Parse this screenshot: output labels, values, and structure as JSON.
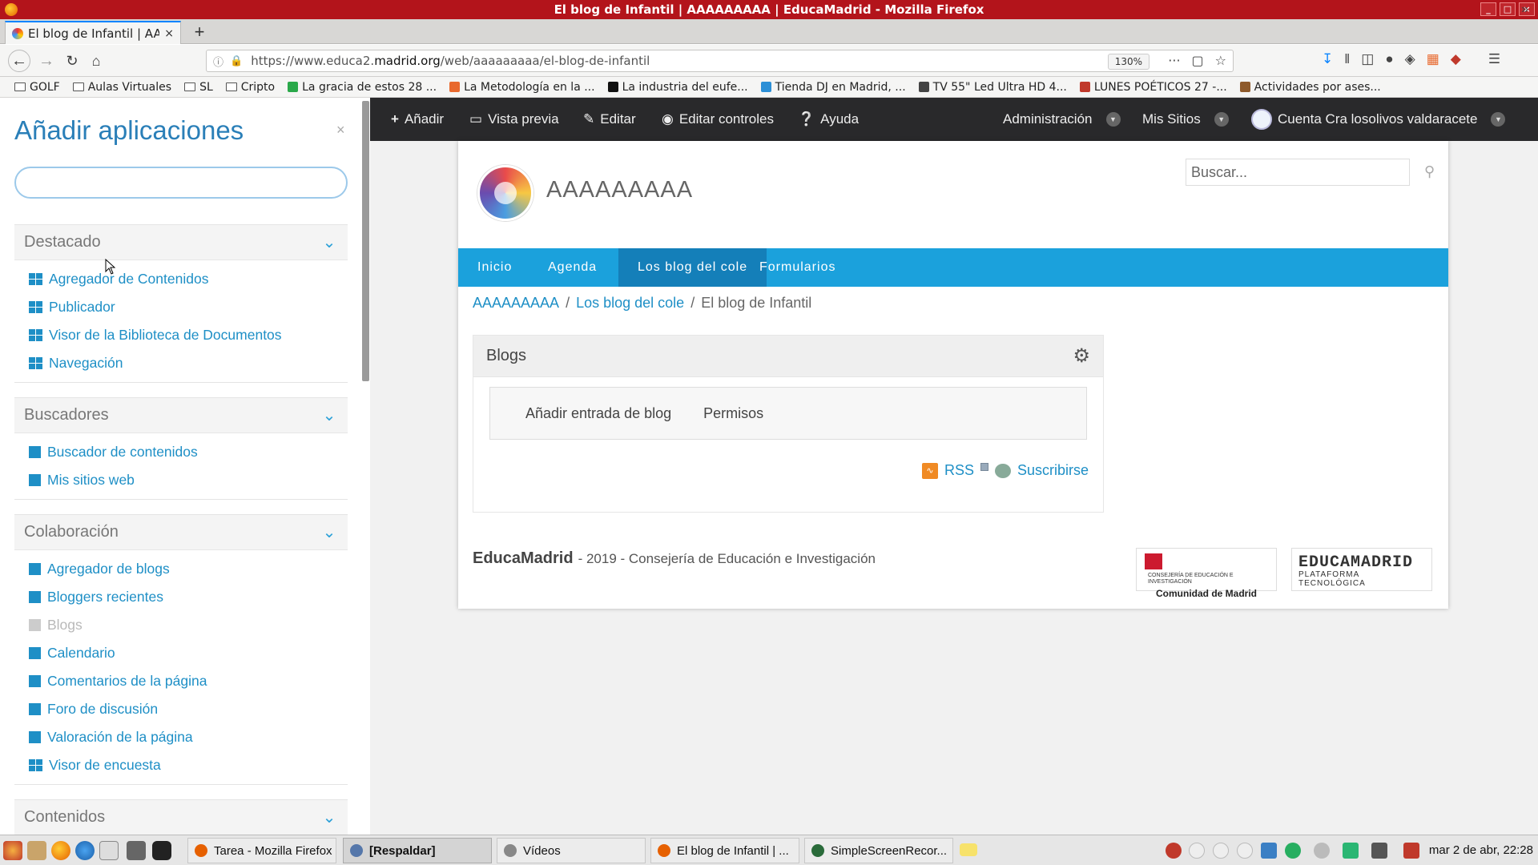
{
  "window": {
    "title": "El blog de Infantil | AAAAAAAAA | EducaMadrid - Mozilla Firefox",
    "controls": [
      "_",
      "□",
      "×"
    ]
  },
  "tabs": [
    {
      "label": "El blog de Infantil | AAAAAA",
      "close": "×",
      "active": true
    }
  ],
  "new_tab": "+",
  "url": {
    "prefix": "https://www.educa2.",
    "domain": "madrid.org",
    "path": "/web/aaaaaaaaa/el-blog-de-infantil",
    "zoom": "130%",
    "more": "···"
  },
  "bookmarks": [
    {
      "label": "GOLF",
      "icon": "folder-icon"
    },
    {
      "label": "Aulas Virtuales",
      "icon": "folder-icon"
    },
    {
      "label": "SL",
      "icon": "folder-icon"
    },
    {
      "label": "Cripto",
      "icon": "folder-icon"
    },
    {
      "label": "La gracia de estos 28 ...",
      "icon": "site-icon",
      "color": "#2aa84a"
    },
    {
      "label": "La Metodología en la ...",
      "icon": "site-icon",
      "color": "#e8692e"
    },
    {
      "label": "La industria del eufe...",
      "icon": "site-icon",
      "color": "#111111"
    },
    {
      "label": "Tienda DJ en Madrid, ...",
      "icon": "site-icon",
      "color": "#2c8fd6"
    },
    {
      "label": "TV 55\" Led Ultra HD 4...",
      "icon": "site-icon",
      "color": "#444444"
    },
    {
      "label": "LUNES POÉTICOS 27 -...",
      "icon": "site-icon",
      "color": "#c0392b"
    },
    {
      "label": "Actividades por ases...",
      "icon": "site-icon",
      "color": "#8e5a2b"
    }
  ],
  "left_panel": {
    "title": "Añadir aplicaciones",
    "close": "×",
    "search_value": "",
    "sections": [
      {
        "title": "Destacado",
        "items": [
          {
            "label": "Agregador de Contenidos",
            "icon": "grid",
            "enabled": true
          },
          {
            "label": "Publicador",
            "icon": "grid",
            "enabled": true
          },
          {
            "label": "Visor de la Biblioteca de Documentos",
            "icon": "grid",
            "enabled": true
          },
          {
            "label": "Navegación",
            "icon": "grid",
            "enabled": true
          }
        ]
      },
      {
        "title": "Buscadores",
        "items": [
          {
            "label": "Buscador de contenidos",
            "icon": "square",
            "enabled": true
          },
          {
            "label": "Mis sitios web",
            "icon": "square",
            "enabled": true
          }
        ]
      },
      {
        "title": "Colaboración",
        "items": [
          {
            "label": "Agregador de blogs",
            "icon": "square",
            "enabled": true
          },
          {
            "label": "Bloggers recientes",
            "icon": "square",
            "enabled": true
          },
          {
            "label": "Blogs",
            "icon": "square",
            "enabled": false
          },
          {
            "label": "Calendario",
            "icon": "square",
            "enabled": true
          },
          {
            "label": "Comentarios de la página",
            "icon": "square",
            "enabled": true
          },
          {
            "label": "Foro de discusión",
            "icon": "square",
            "enabled": true
          },
          {
            "label": "Valoración de la página",
            "icon": "square",
            "enabled": true
          },
          {
            "label": "Visor de encuesta",
            "icon": "grid",
            "enabled": true
          }
        ]
      },
      {
        "title": "Contenidos",
        "items": []
      }
    ]
  },
  "admin_bar": {
    "add": "Añadir",
    "preview": "Vista previa",
    "edit": "Editar",
    "edit_controls": "Editar controles",
    "help": "Ayuda",
    "administration": "Administración",
    "my_sites": "Mis Sitios",
    "account": "Cuenta Cra losolivos valdaracete"
  },
  "site": {
    "name": "AAAAAAAAA",
    "search_placeholder": "Buscar...",
    "nav": [
      "Inicio",
      "Agenda",
      "Los blog del cole",
      "Formularios"
    ],
    "nav_active": 2,
    "breadcrumb": [
      "AAAAAAAAA",
      "Los blog del cole",
      "El blog de Infantil"
    ],
    "breadcrumb_sep": "/",
    "blogs_portlet": {
      "title": "Blogs",
      "add_entry": "Añadir entrada de blog",
      "permissions": "Permisos",
      "rss": "RSS",
      "subscribe": "Suscribirse"
    },
    "footer": {
      "brand": "EducaMadrid",
      "text": "- 2019 - Consejería de Educación e Investigación"
    },
    "logos": {
      "cm_small": "CONSEJERÍA DE EDUCACIÓN E INVESTIGACIÓN",
      "cm_big": "Comunidad de Madrid",
      "em_big": "EDUCAMADRID",
      "em_small": "PLATAFORMA TECNOLÓGICA"
    }
  },
  "taskbar": {
    "tasks": [
      {
        "label": "Tarea - Mozilla Firefox",
        "active": false,
        "color": "#e66000"
      },
      {
        "label": "[Respaldar]",
        "active": true,
        "color": "#5577aa"
      },
      {
        "label": "Vídeos",
        "active": false,
        "color": "#888888"
      },
      {
        "label": "El blog de Infantil | ...",
        "active": false,
        "color": "#e66000"
      },
      {
        "label": "SimpleScreenRecor...",
        "active": false,
        "color": "#2a6b3a"
      }
    ],
    "clock": "mar 2 de abr, 22:28"
  },
  "colors": {
    "accent": "#1ba1dc",
    "title_bar": "#b3141b",
    "admin_bar": "#29292b",
    "link": "#1e8fc6"
  }
}
